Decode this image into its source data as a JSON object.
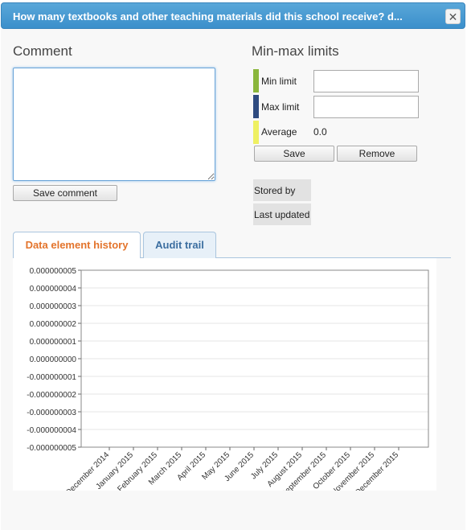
{
  "dialog": {
    "title": "How many textbooks and other teaching materials did this school receive? d...",
    "close_icon": "close-icon"
  },
  "comment": {
    "heading": "Comment",
    "value": "",
    "save_label": "Save comment"
  },
  "minmax": {
    "heading": "Min-max limits",
    "min_label": "Min limit",
    "max_label": "Max limit",
    "average_label": "Average",
    "average_value": "0.0",
    "min_value": "",
    "max_value": "",
    "save_label": "Save",
    "remove_label": "Remove",
    "stored_by_label": "Stored by",
    "last_updated_label": "Last updated",
    "colors": {
      "min": "#8ab63c",
      "max": "#2f4b80",
      "average": "#eef062"
    }
  },
  "tabs": [
    {
      "label": "Data element history",
      "active": true
    },
    {
      "label": "Audit trail",
      "active": false
    }
  ],
  "chart_data": {
    "type": "line",
    "title": "",
    "xlabel": "",
    "ylabel": "",
    "categories": [
      "December 2014",
      "January 2015",
      "February 2015",
      "March 2015",
      "April 2015",
      "May 2015",
      "June 2015",
      "July 2015",
      "August 2015",
      "September 2015",
      "October 2015",
      "November 2015",
      "December 2015"
    ],
    "y_ticks": [
      "0.000000005",
      "0.000000004",
      "0.000000003",
      "0.000000002",
      "0.000000001",
      "0.000000000",
      "-0.000000001",
      "-0.000000002",
      "-0.000000003",
      "-0.000000004",
      "-0.000000005"
    ],
    "ylim": [
      -5e-09,
      5e-09
    ],
    "series": [],
    "grid": true
  }
}
